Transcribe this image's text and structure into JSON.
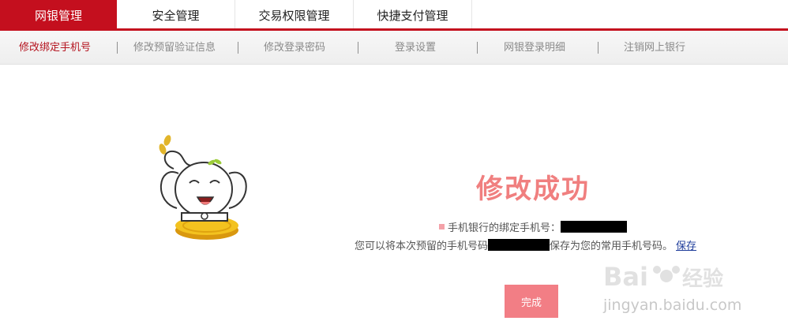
{
  "top_tabs": [
    {
      "label": "网银管理"
    },
    {
      "label": "安全管理"
    },
    {
      "label": "交易权限管理"
    },
    {
      "label": "快捷支付管理"
    }
  ],
  "sub_nav": [
    {
      "label": "修改绑定手机号"
    },
    {
      "label": "修改预留验证信息"
    },
    {
      "label": "修改登录密码"
    },
    {
      "label": "登录设置"
    },
    {
      "label": "网银登录明细"
    },
    {
      "label": "注销网上银行"
    }
  ],
  "result": {
    "title": "修改成功",
    "bound_phone_label": "手机银行的绑定手机号：",
    "line2_prefix": "您可以将本次预留的手机号码",
    "line2_suffix": "保存为您的常用手机号码。",
    "save_link": "保存",
    "done_button": "完成"
  },
  "watermark": {
    "brand_latin": "Bai",
    "brand_cn": "经验",
    "url": "jingyan.baidu.com"
  },
  "colors": {
    "accent_red": "#c40f1e",
    "success_pink": "#f07f7f",
    "button_pink": "#f27e85",
    "link_blue": "#1f3d9b"
  }
}
